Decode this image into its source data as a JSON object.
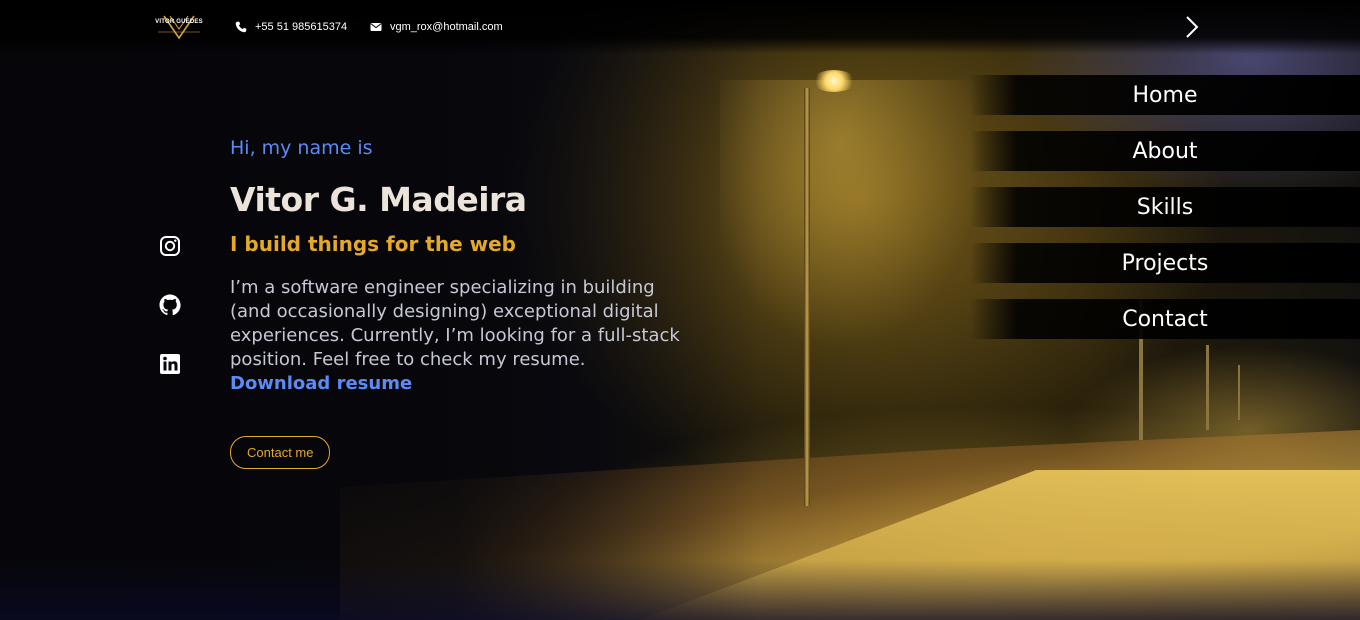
{
  "topbar": {
    "logo_text": "VITOR GUEDES",
    "phone": "+55 51 985615374",
    "email": "vgm_rox@hotmail.com",
    "menu_icon": "chevron-right-icon"
  },
  "nav": {
    "items": [
      {
        "label": "Home"
      },
      {
        "label": "About"
      },
      {
        "label": "Skills"
      },
      {
        "label": "Projects"
      },
      {
        "label": "Contact"
      }
    ]
  },
  "social": {
    "icons": [
      "instagram-icon",
      "github-icon",
      "linkedin-icon"
    ]
  },
  "hero": {
    "greeting": "Hi, my name is",
    "name": "Vitor G. Madeira",
    "tagline": "I build things for the web",
    "bio": "I’m a software engineer specializing in building (and occasionally designing) exceptional digital experiences. Currently, I’m looking for a full-stack position. Feel free to check my resume. ",
    "resume_link": "Download resume",
    "contact_button": "Contact me"
  },
  "colors": {
    "accent_blue": "#5b8bf5",
    "accent_gold": "#e3a92a",
    "name_color": "#ece4da",
    "text_muted": "#c7c8d6"
  }
}
